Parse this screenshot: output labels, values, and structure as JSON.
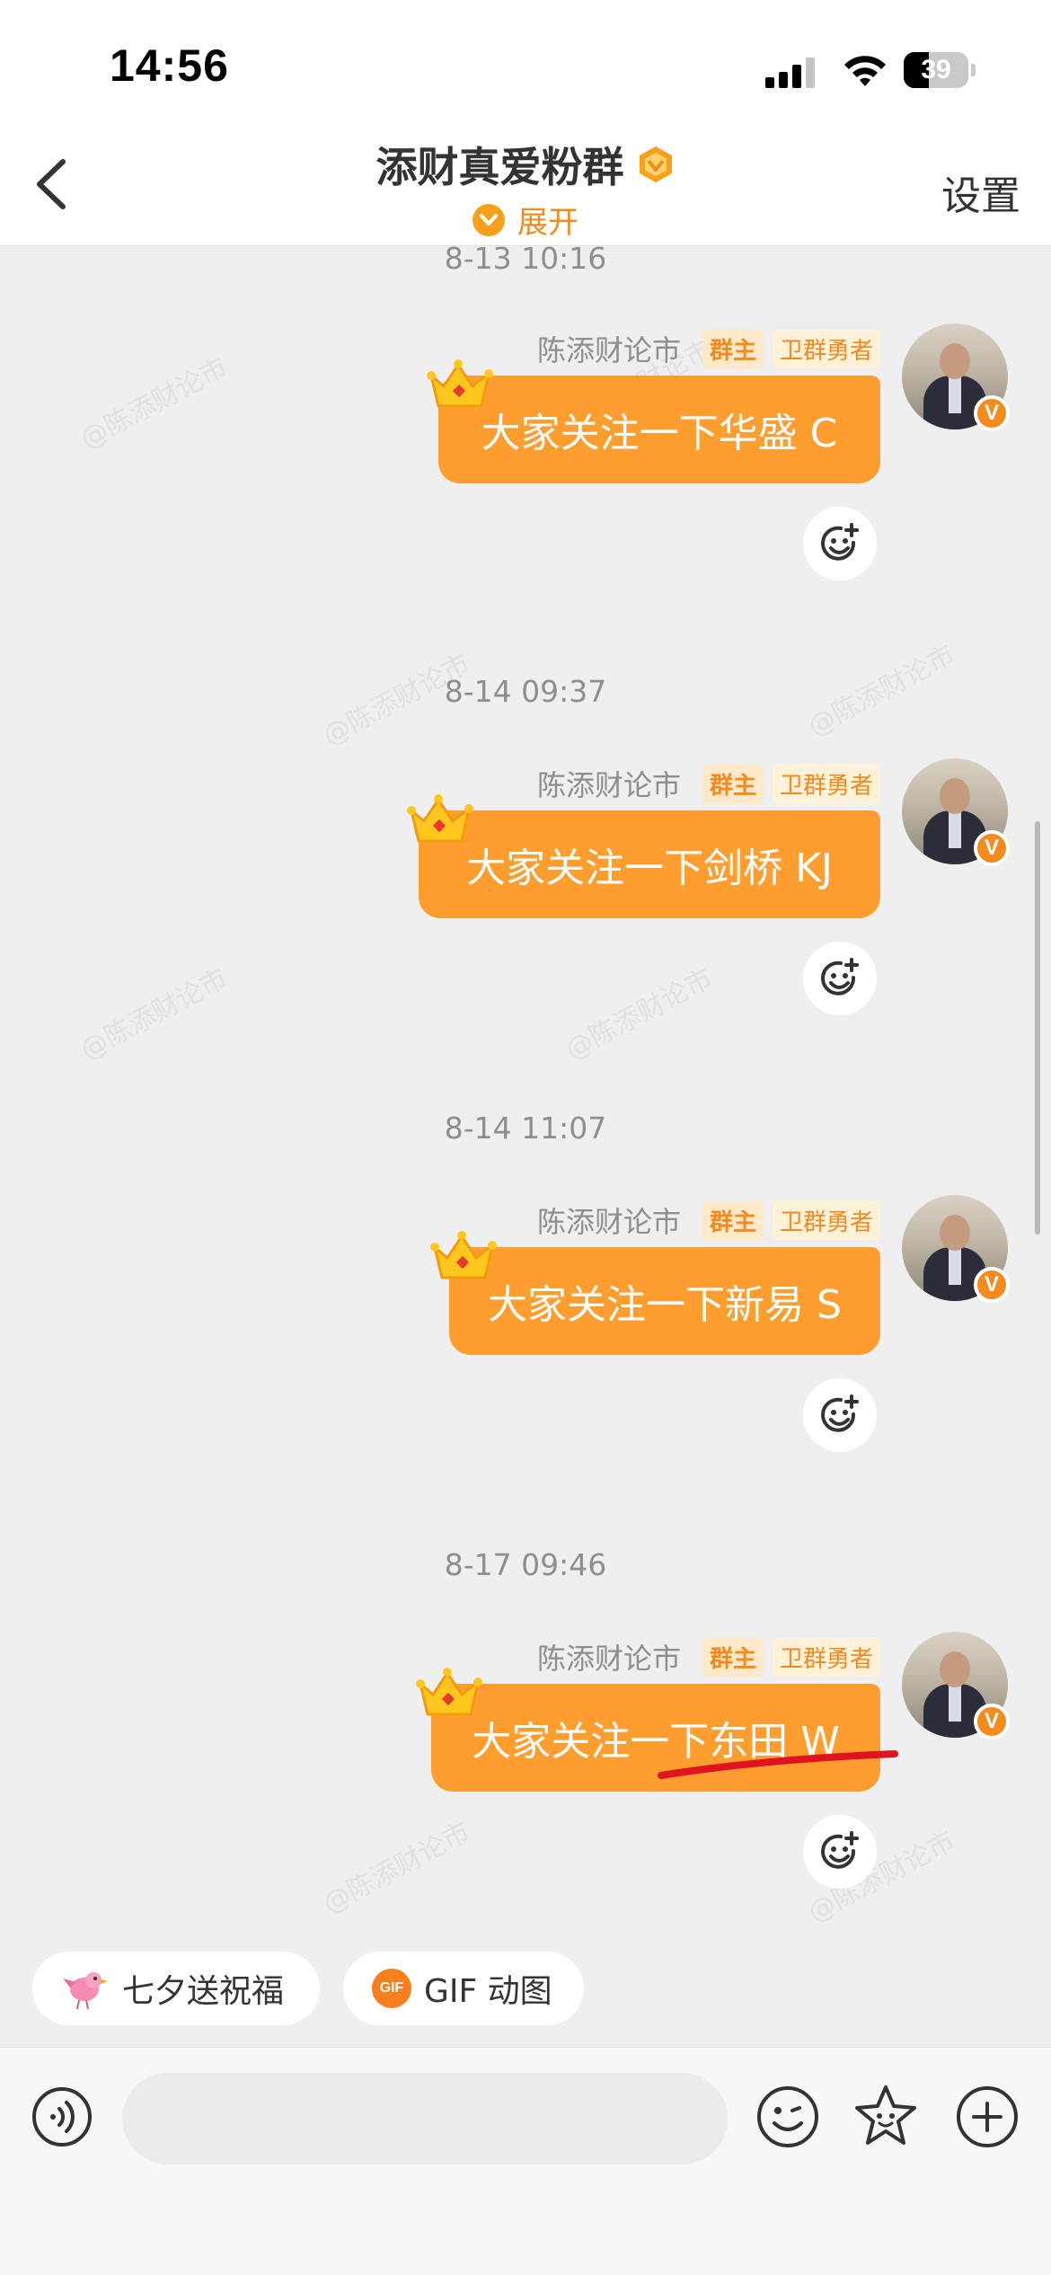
{
  "status_bar": {
    "time": "14:56",
    "battery": "39",
    "battery_level": 0.39
  },
  "header": {
    "title": "添财真爱粉群",
    "expand_label": "展开",
    "settings_label": "设置"
  },
  "messages": [
    {
      "timestamp": "8-13 10:16",
      "sender": "陈添财论市",
      "tags": [
        "群主",
        "卫群勇者"
      ],
      "text": "大家关注一下华盛 C"
    },
    {
      "timestamp": "8-14 09:37",
      "sender": "陈添财论市",
      "tags": [
        "群主",
        "卫群勇者"
      ],
      "text": "大家关注一下剑桥 KJ"
    },
    {
      "timestamp": "8-14 11:07",
      "sender": "陈添财论市",
      "tags": [
        "群主",
        "卫群勇者"
      ],
      "text": "大家关注一下新易 S"
    },
    {
      "timestamp": "8-17 09:46",
      "sender": "陈添财论市",
      "tags": [
        "群主",
        "卫群勇者"
      ],
      "text": "大家关注一下东田 W"
    }
  ],
  "watermark_text": "@陈添财论市",
  "quick_chips": [
    {
      "label": "七夕送祝福",
      "icon": "bird-icon"
    },
    {
      "label": "GIF 动图",
      "icon": "gif-icon",
      "icon_text": "GIF"
    }
  ],
  "input": {
    "placeholder": ""
  },
  "colors": {
    "bubble": "#ff9d2f",
    "accent": "#f5891e",
    "underline": "#e0141e"
  }
}
